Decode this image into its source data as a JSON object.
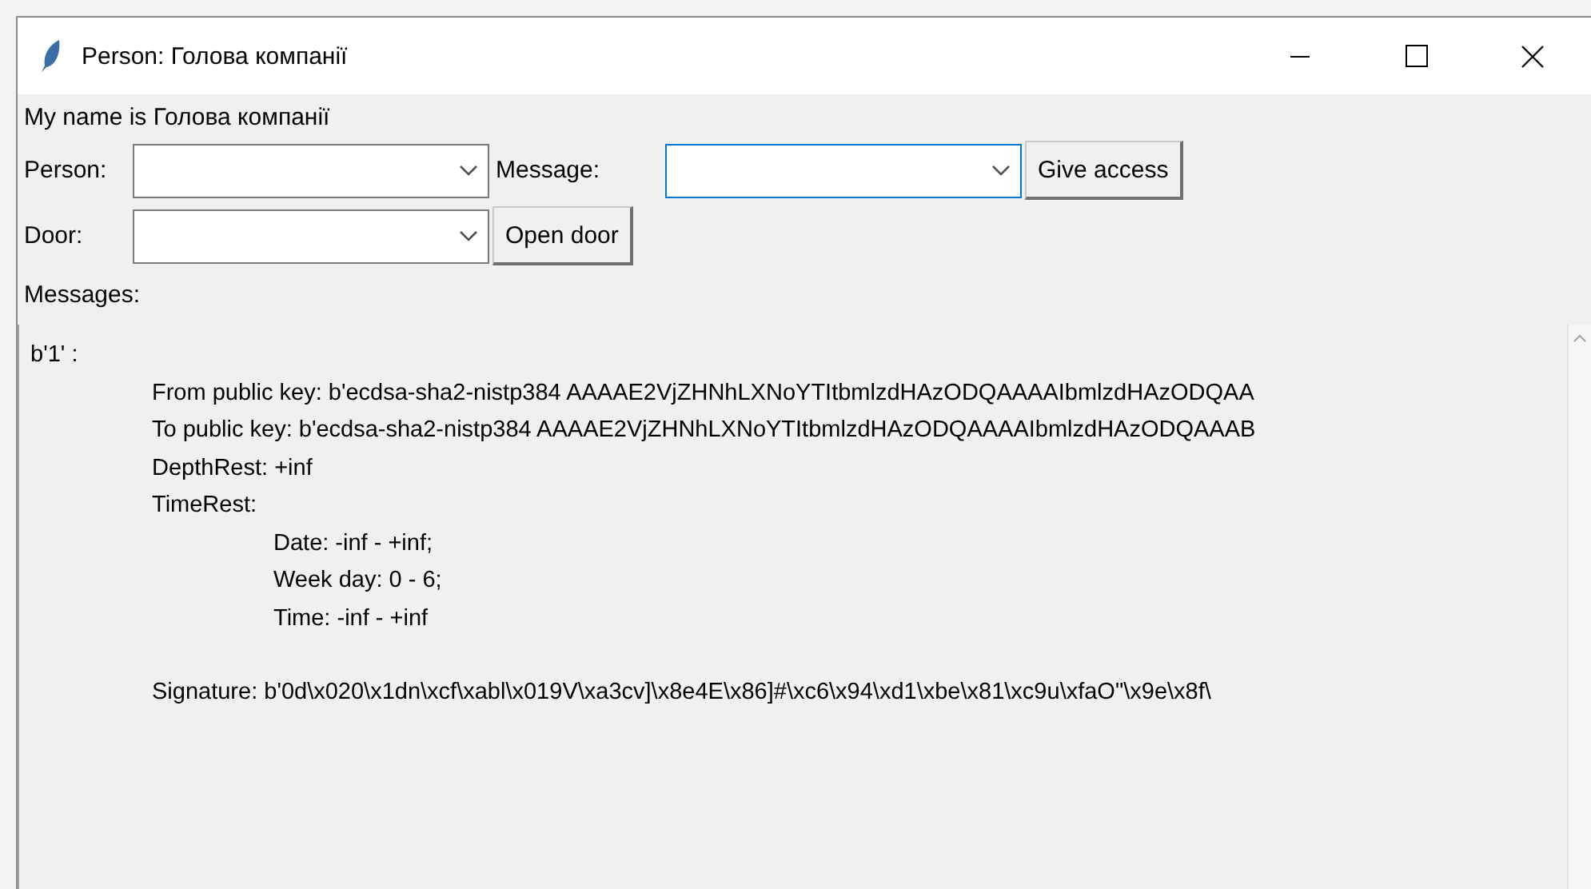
{
  "window": {
    "title": "Person: Голова компанії"
  },
  "greeting": "My name is Голова компанії",
  "person_field": {
    "label": "Person:",
    "focused": false
  },
  "message_field": {
    "label": "Message:",
    "focused": true
  },
  "give_access_button": "Give access",
  "door_field": {
    "label": "Door:",
    "focused": false
  },
  "open_door_button": "Open door",
  "messages_label": "Messages:",
  "messages": [
    {
      "text": "b'1' :",
      "children": [
        {
          "kind": "line",
          "text": "From public key: b'ecdsa-sha2-nistp384 AAAAE2VjZHNhLXNoYTItbmlzdHAzODQAAAAIbmlzdHAzODQAA"
        },
        {
          "kind": "line",
          "text": "To public key: b'ecdsa-sha2-nistp384 AAAAE2VjZHNhLXNoYTItbmlzdHAzODQAAAAIbmlzdHAzODQAAAB"
        },
        {
          "kind": "line",
          "text": "DepthRest: +inf"
        },
        {
          "kind": "line",
          "text": "TimeRest:",
          "children": [
            {
              "text": "Date: -inf - +inf;"
            },
            {
              "text": "Week day: 0 - 6;"
            },
            {
              "text": "Time: -inf - +inf"
            }
          ]
        },
        {
          "kind": "signature",
          "text": "Signature: b'0d\\x020\\x1dn\\xcf\\xabl\\x019V\\xa3cv]\\x8e4E\\x86]#\\xc6\\x94\\xd1\\xbe\\x81\\xc9u\\xfaO\"\\x9e\\x8f\\"
        }
      ]
    }
  ]
}
